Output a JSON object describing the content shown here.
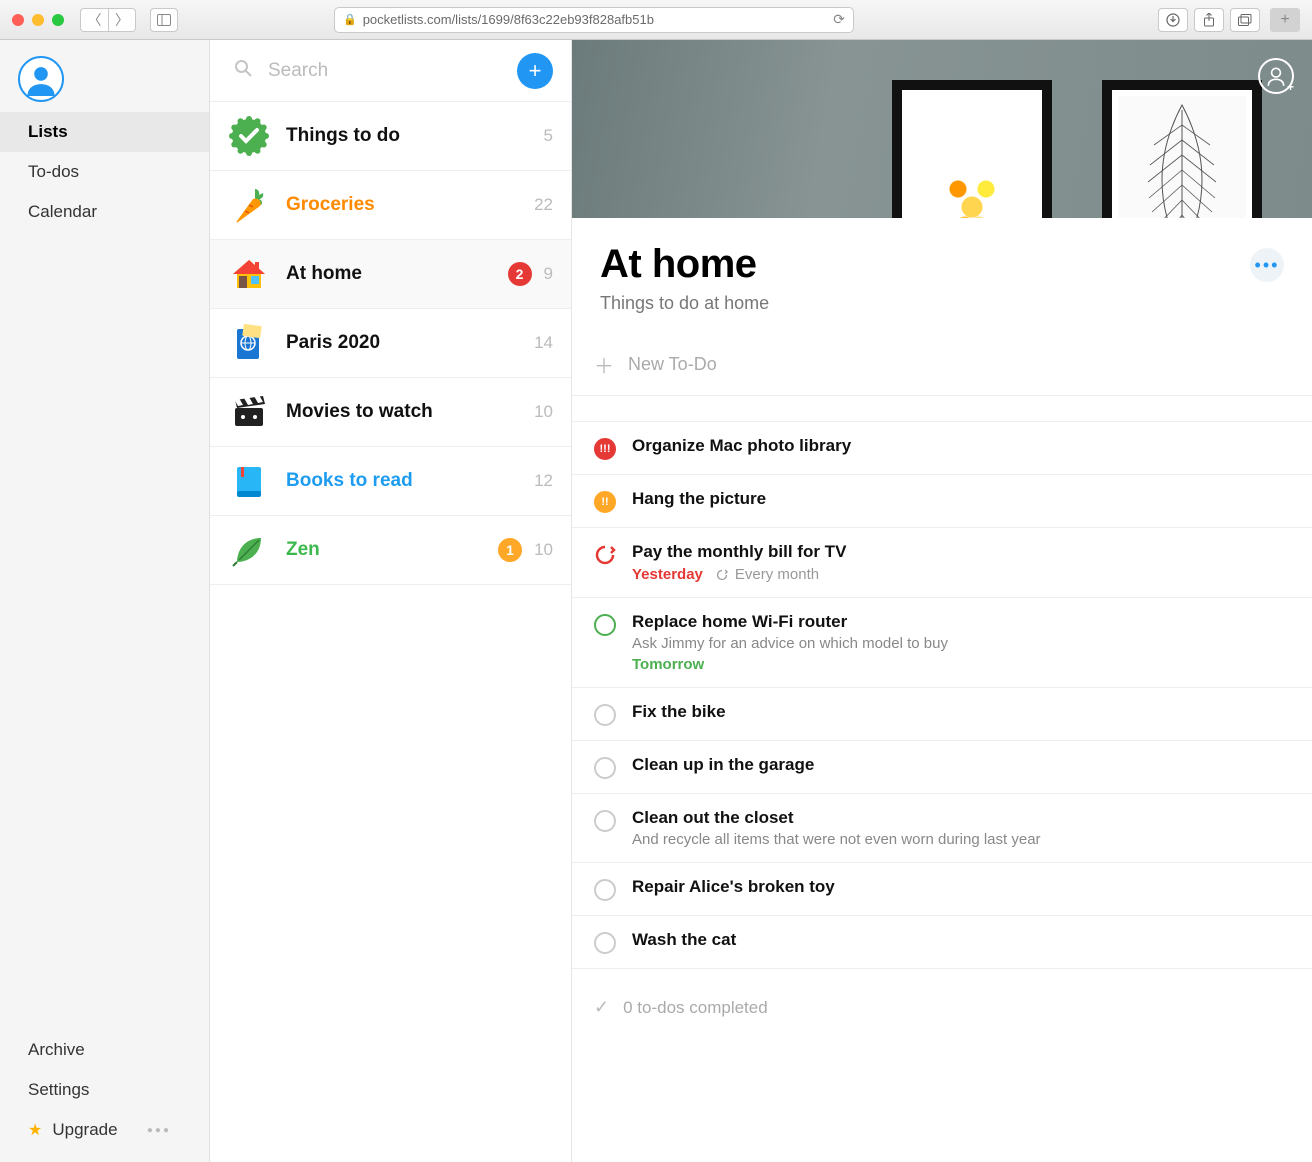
{
  "browser": {
    "url": "pocketlists.com/lists/1699/8f63c22eb93f828afb51b"
  },
  "sidebar": {
    "nav": [
      {
        "label": "Lists",
        "active": true
      },
      {
        "label": "To-dos",
        "active": false
      },
      {
        "label": "Calendar",
        "active": false
      }
    ],
    "bottom": {
      "archive": "Archive",
      "settings": "Settings",
      "upgrade": "Upgrade"
    }
  },
  "search": {
    "placeholder": "Search"
  },
  "lists": [
    {
      "title": "Things to do",
      "count": "5",
      "color": "",
      "icon": "check",
      "badge": null
    },
    {
      "title": "Groceries",
      "count": "22",
      "color": "orange",
      "icon": "carrot",
      "badge": null
    },
    {
      "title": "At home",
      "count": "9",
      "color": "",
      "icon": "house",
      "badge": {
        "text": "2",
        "color": "red"
      },
      "selected": true
    },
    {
      "title": "Paris 2020",
      "count": "14",
      "color": "",
      "icon": "passport",
      "badge": null
    },
    {
      "title": "Movies to watch",
      "count": "10",
      "color": "",
      "icon": "clapper",
      "badge": null
    },
    {
      "title": "Books to read",
      "count": "12",
      "color": "blue",
      "icon": "book",
      "badge": null
    },
    {
      "title": "Zen",
      "count": "10",
      "color": "green",
      "icon": "leaf",
      "badge": {
        "text": "1",
        "color": "orange"
      }
    }
  ],
  "main": {
    "title": "At home",
    "subtitle": "Things to do at home",
    "new_todo_placeholder": "New To-Do",
    "completed_label": "0 to-dos completed"
  },
  "todos": [
    {
      "title": "Organize Mac photo library",
      "note": null,
      "check": "red-fill",
      "check_symbol": "!!!",
      "meta": null
    },
    {
      "title": "Hang the picture",
      "note": null,
      "check": "orange-fill",
      "check_symbol": "!!",
      "meta": null
    },
    {
      "title": "Pay the monthly bill for TV",
      "note": null,
      "check": "repeat",
      "meta": {
        "left": "Yesterday",
        "left_color": "red",
        "right": "Every month",
        "right_icon": "repeat"
      }
    },
    {
      "title": "Replace home Wi-Fi router",
      "note": "Ask Jimmy for an advice on which model to buy",
      "check": "green-ring",
      "meta": {
        "left": "Tomorrow",
        "left_color": "green"
      }
    },
    {
      "title": "Fix the bike",
      "note": null,
      "check": "",
      "meta": null
    },
    {
      "title": "Clean up in the garage",
      "note": null,
      "check": "",
      "meta": null
    },
    {
      "title": "Clean out the closet",
      "note": "And recycle all items that were not even worn during last year",
      "check": "",
      "meta": null
    },
    {
      "title": "Repair Alice's broken toy",
      "note": null,
      "check": "",
      "meta": null
    },
    {
      "title": "Wash the cat",
      "note": null,
      "check": "",
      "meta": null
    }
  ]
}
